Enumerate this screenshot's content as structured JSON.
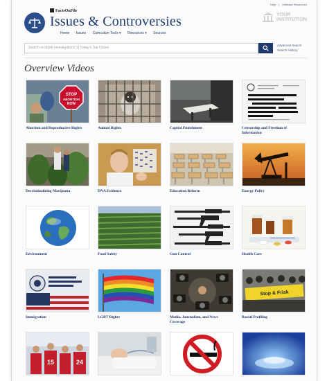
{
  "header": {
    "utility_links": [
      "Help",
      "Infobase Resources"
    ],
    "publisher": "FactsOnFile",
    "title": "Issues & Controversies",
    "nav": [
      "Home",
      "Issues",
      "Curriculum Tools ▾",
      "Resources ▾",
      "Sources"
    ],
    "institution": [
      "YOUR",
      "INSTITUTION"
    ]
  },
  "search": {
    "placeholder": "Search In-depth Investigations of Today's Top Issues",
    "advanced": "Advanced Search",
    "history": "Search History"
  },
  "main": {
    "heading": "Overview Videos",
    "videos": [
      {
        "label": "Abortion and Reproductive Rights",
        "icon": "stop-sign-protest"
      },
      {
        "label": "Animal Rights",
        "icon": "monkey-cage"
      },
      {
        "label": "Capital Punishment",
        "icon": "execution-chamber"
      },
      {
        "label": "Censorship and Freedom of Information",
        "icon": "redacted-document"
      },
      {
        "label": "Decriminalizing Marijuana",
        "icon": "cannabis-plants"
      },
      {
        "label": "DNA Evidence",
        "icon": "scientist-gel"
      },
      {
        "label": "Education Reform",
        "icon": "classroom-desks"
      },
      {
        "label": "Energy Policy",
        "icon": "oil-pump"
      },
      {
        "label": "Environment",
        "icon": "earth-globe"
      },
      {
        "label": "Food Safety",
        "icon": "crop-field"
      },
      {
        "label": "Gun Control",
        "icon": "rifles"
      },
      {
        "label": "Health Care",
        "icon": "medicine-bottles"
      },
      {
        "label": "Immigration",
        "icon": "uscis-seal-flag"
      },
      {
        "label": "LGBT Rights",
        "icon": "rainbow-flag"
      },
      {
        "label": "Media, Journalism, and News Coverage",
        "icon": "press-cameras"
      },
      {
        "label": "Racial Profiling",
        "icon": "protest-banner"
      },
      {
        "label": "",
        "icon": "sports-team"
      },
      {
        "label": "",
        "icon": "hospital-patient"
      },
      {
        "label": "",
        "icon": "no-smoking-sign"
      },
      {
        "label": "",
        "icon": "blue-lab"
      }
    ]
  },
  "colors": {
    "brand": "#1f3b6b",
    "link": "#1f3b6b"
  }
}
